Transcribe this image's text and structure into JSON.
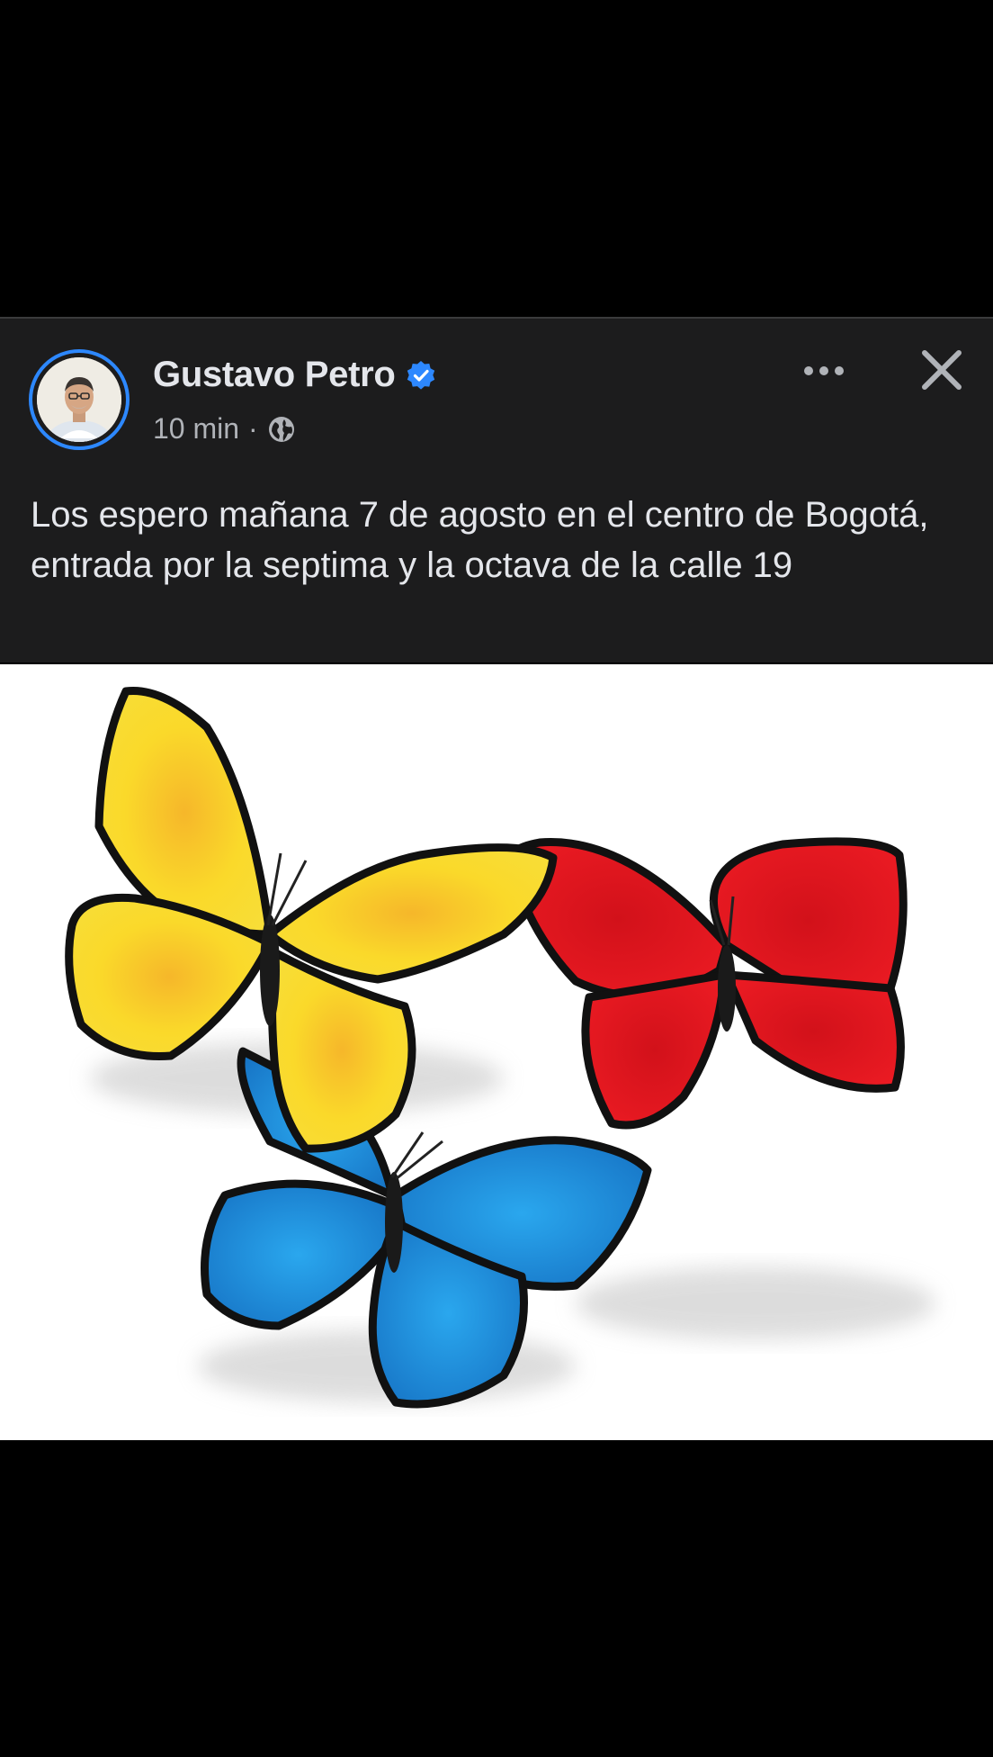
{
  "post": {
    "author_name": "Gustavo Petro",
    "timestamp": "10 min",
    "separator": "·",
    "audience_icon": "globe-icon",
    "verified_icon": "verified-badge-icon",
    "more_icon": "more-options-icon",
    "close_icon": "close-icon",
    "text": "Los espero mañana 7 de agosto en el centro de Bogotá, entrada por la septima y la octava de la calle 19"
  },
  "image": {
    "description_icon": "butterflies-image",
    "colors": {
      "yellow": "#f9d61c",
      "blue": "#1d8fd8",
      "red": "#e3131b"
    }
  },
  "theme": {
    "background": "#000000",
    "card": "#1c1c1d",
    "accent": "#2d88ff",
    "text_primary": "#e4e6eb",
    "text_secondary": "#b0b3b8"
  }
}
